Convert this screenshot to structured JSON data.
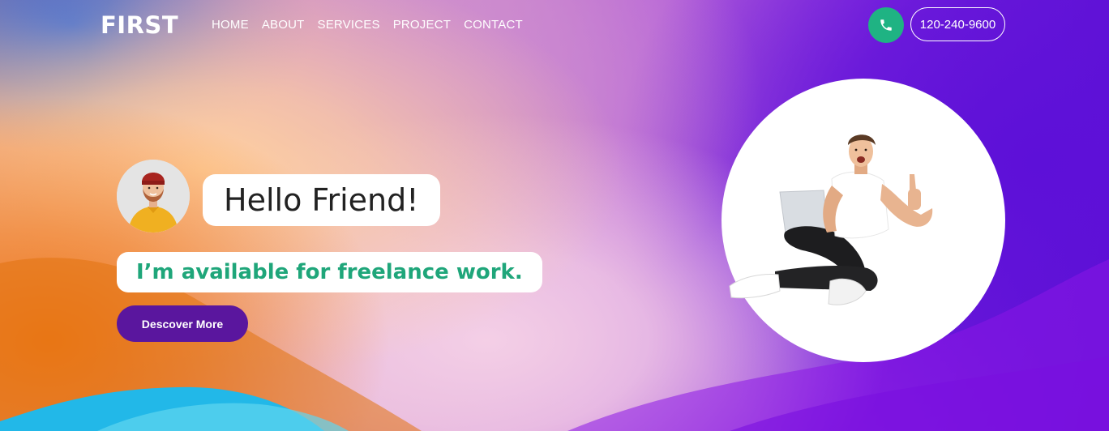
{
  "brand": {
    "logo": "FIRST"
  },
  "nav": {
    "items": [
      {
        "label": "HOME"
      },
      {
        "label": "ABOUT"
      },
      {
        "label": "SERVICES"
      },
      {
        "label": "PROJECT"
      },
      {
        "label": "CONTACT"
      }
    ]
  },
  "contact": {
    "phone_icon": "phone-icon",
    "phone_number": "120-240-9600"
  },
  "hero": {
    "greeting": "Hello Friend!",
    "tagline": "I’m available for freelance work.",
    "cta_label": "Descover More"
  },
  "colors": {
    "accent_green": "#1fb383",
    "tagline_green": "#1fa67a",
    "button_purple": "#5a169e"
  }
}
